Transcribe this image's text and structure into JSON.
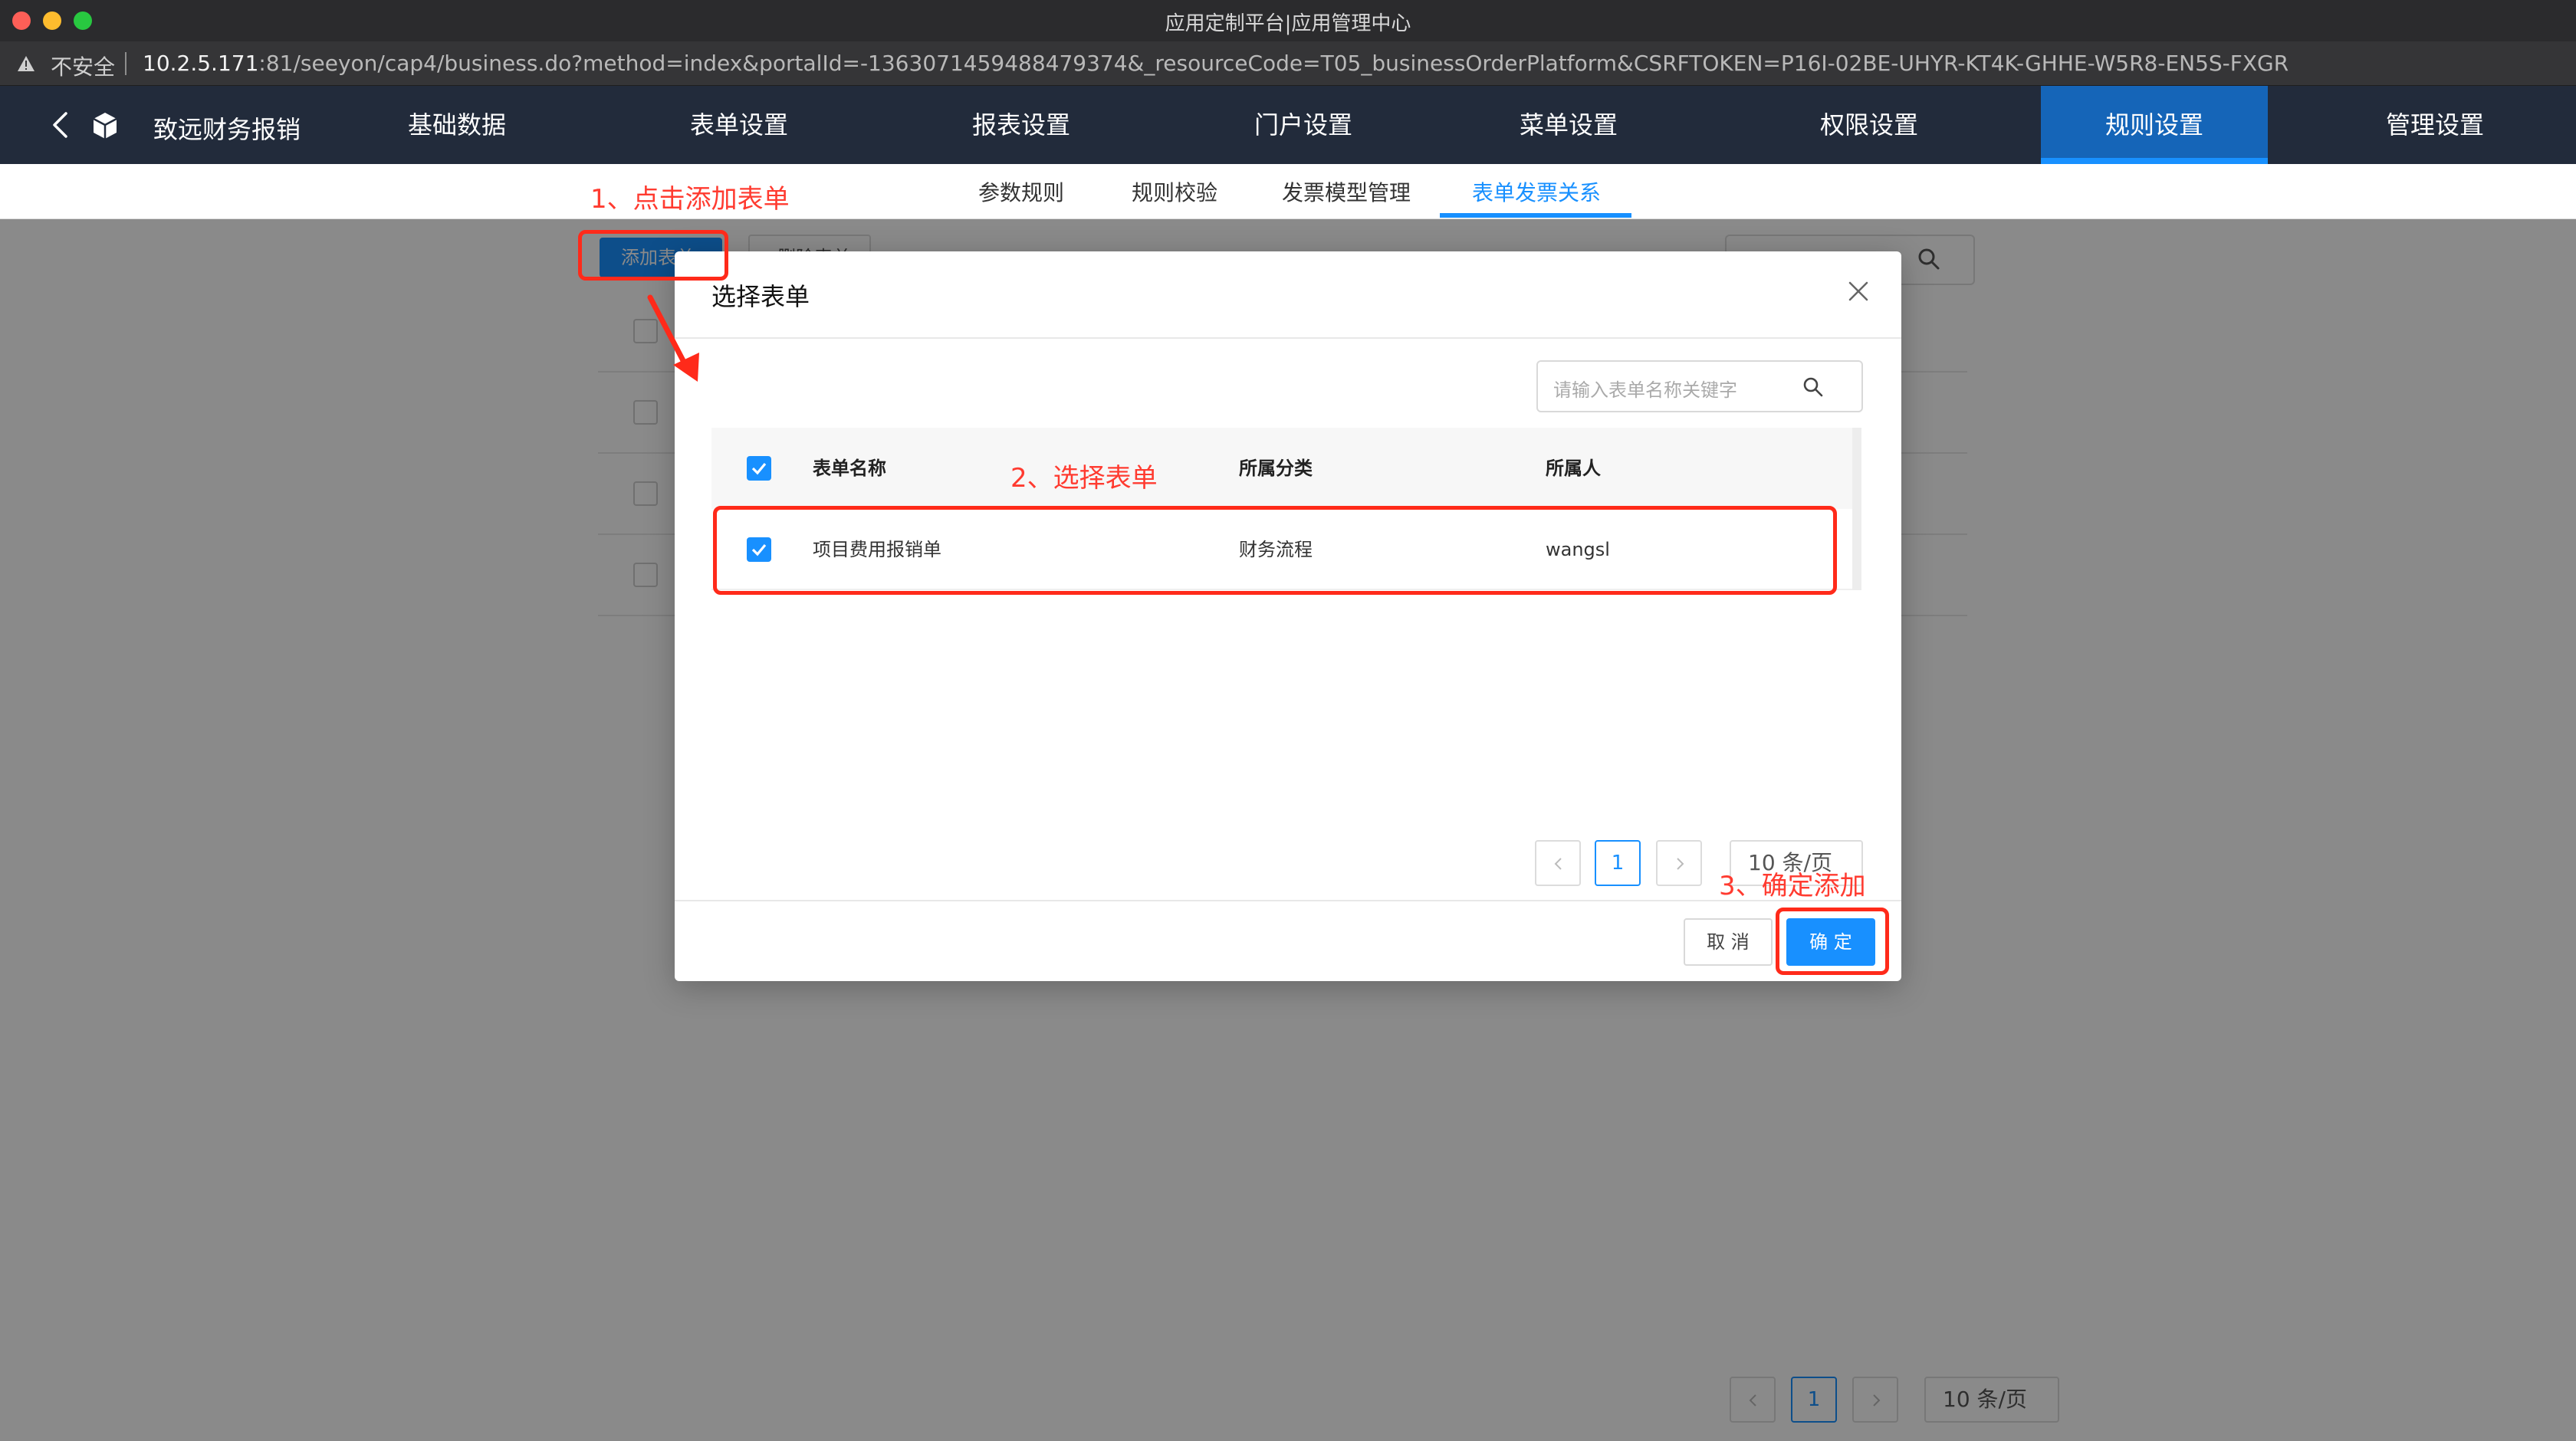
{
  "window": {
    "title": "应用定制平台|应用管理中心",
    "insecure_label": "不安全",
    "url_host": "10.2.5.171",
    "url_rest": ":81/seeyon/cap4/business.do?method=index&portalId=-1363071459488479374&_resourceCode=T05_businessOrderPlatform&CSRFTOKEN=P16I-02BE-UHYR-KT4K-GHHE-W5R8-EN5S-FXGR"
  },
  "appnav": {
    "app_name": "致远财务报销",
    "items": [
      {
        "label": "基础数据"
      },
      {
        "label": "表单设置"
      },
      {
        "label": "报表设置"
      },
      {
        "label": "门户设置"
      },
      {
        "label": "菜单设置"
      },
      {
        "label": "权限设置"
      },
      {
        "label": "规则设置"
      },
      {
        "label": "管理设置"
      }
    ],
    "active_item": "规则设置"
  },
  "subnav": {
    "tabs": [
      {
        "label": "参数规则"
      },
      {
        "label": "规则校验"
      },
      {
        "label": "发票模型管理"
      },
      {
        "label": "表单发票关系"
      }
    ],
    "active_tab": "表单发票关系"
  },
  "background": {
    "add_form_button": "添加表单",
    "delete_form_button": "删除表单",
    "pager": {
      "current_page": "1",
      "page_size": "10 条/页"
    }
  },
  "modal": {
    "title": "选择表单",
    "search_placeholder": "请输入表单名称关键字",
    "columns": {
      "name": "表单名称",
      "category": "所属分类",
      "owner": "所属人"
    },
    "rows": [
      {
        "name": "项目费用报销单",
        "category": "财务流程",
        "owner": "wangsl",
        "checked": true
      }
    ],
    "pager": {
      "current_page": "1",
      "page_size": "10 条/页"
    },
    "cancel_label": "取 消",
    "ok_label": "确 定"
  },
  "annotations": {
    "step1": "1、点击添加表单",
    "step2": "2、选择表单",
    "step3": "3、确定添加"
  },
  "colors": {
    "primary": "#1890ff",
    "nav_bg": "#222b3b",
    "nav_active": "#1565b8",
    "annotation": "#ff2a1a"
  }
}
